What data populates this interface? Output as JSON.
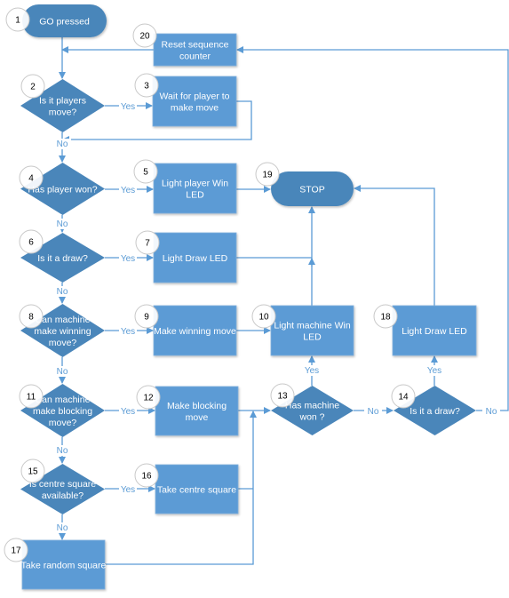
{
  "diagram": {
    "type": "flowchart",
    "colors": {
      "process_fill": "#5b9bd5",
      "decision_fill": "#4a86ba",
      "terminal_fill": "#4a86ba",
      "connector": "#5b9bd5",
      "label": "#5b9bd5",
      "number_circle_stroke": "#c8c8c8"
    },
    "nodes": [
      {
        "id": "1",
        "shape": "terminal",
        "lines": [
          "GO pressed"
        ]
      },
      {
        "id": "2",
        "shape": "decision",
        "lines": [
          "Is it players",
          "move?"
        ]
      },
      {
        "id": "3",
        "shape": "process",
        "lines": [
          "Wait for player to",
          "make move"
        ]
      },
      {
        "id": "4",
        "shape": "decision",
        "lines": [
          "Has player won?"
        ]
      },
      {
        "id": "5",
        "shape": "process",
        "lines": [
          "Light player Win",
          "LED"
        ]
      },
      {
        "id": "6",
        "shape": "decision",
        "lines": [
          "Is it a draw?"
        ]
      },
      {
        "id": "7",
        "shape": "process",
        "lines": [
          "Light Draw LED"
        ]
      },
      {
        "id": "8",
        "shape": "decision",
        "lines": [
          "Can machine",
          "make winning",
          "move?"
        ]
      },
      {
        "id": "9",
        "shape": "process",
        "lines": [
          "Make winning move"
        ]
      },
      {
        "id": "10",
        "shape": "process",
        "lines": [
          "Light machine Win",
          "LED"
        ]
      },
      {
        "id": "11",
        "shape": "decision",
        "lines": [
          "Can machine",
          "make blocking",
          "move?"
        ]
      },
      {
        "id": "12",
        "shape": "process",
        "lines": [
          "Make blocking",
          "move"
        ]
      },
      {
        "id": "13",
        "shape": "decision",
        "lines": [
          "Has machine",
          "won ?"
        ]
      },
      {
        "id": "14",
        "shape": "decision",
        "lines": [
          "Is it a draw?"
        ]
      },
      {
        "id": "15",
        "shape": "decision",
        "lines": [
          "Is centre square",
          "available?"
        ]
      },
      {
        "id": "16",
        "shape": "process",
        "lines": [
          "Take centre square"
        ]
      },
      {
        "id": "17",
        "shape": "process",
        "lines": [
          "Take random square"
        ]
      },
      {
        "id": "18",
        "shape": "process",
        "lines": [
          "Light Draw LED"
        ]
      },
      {
        "id": "19",
        "shape": "terminal",
        "lines": [
          "STOP"
        ]
      },
      {
        "id": "20",
        "shape": "process",
        "lines": [
          "Reset sequence",
          "counter"
        ]
      }
    ],
    "edges": [
      {
        "from": "1",
        "to": "2",
        "label": ""
      },
      {
        "from": "20",
        "to": "2",
        "label": ""
      },
      {
        "from": "2",
        "to": "3",
        "label": "Yes"
      },
      {
        "from": "2",
        "to": "4",
        "label": "No"
      },
      {
        "from": "3",
        "to": "4",
        "label": ""
      },
      {
        "from": "4",
        "to": "5",
        "label": "Yes"
      },
      {
        "from": "4",
        "to": "6",
        "label": "No"
      },
      {
        "from": "5",
        "to": "19",
        "label": ""
      },
      {
        "from": "6",
        "to": "7",
        "label": "Yes"
      },
      {
        "from": "6",
        "to": "8",
        "label": "No"
      },
      {
        "from": "7",
        "to": "19",
        "label": ""
      },
      {
        "from": "8",
        "to": "9",
        "label": "Yes"
      },
      {
        "from": "8",
        "to": "11",
        "label": "No"
      },
      {
        "from": "9",
        "to": "10",
        "label": ""
      },
      {
        "from": "10",
        "to": "19",
        "label": ""
      },
      {
        "from": "11",
        "to": "12",
        "label": "Yes"
      },
      {
        "from": "11",
        "to": "15",
        "label": "No"
      },
      {
        "from": "12",
        "to": "13",
        "label": ""
      },
      {
        "from": "13",
        "to": "10",
        "label": "Yes"
      },
      {
        "from": "13",
        "to": "14",
        "label": "No"
      },
      {
        "from": "14",
        "to": "18",
        "label": "Yes"
      },
      {
        "from": "14",
        "to": "20",
        "label": "No"
      },
      {
        "from": "18",
        "to": "19",
        "label": ""
      },
      {
        "from": "15",
        "to": "16",
        "label": "Yes"
      },
      {
        "from": "15",
        "to": "17",
        "label": "No"
      },
      {
        "from": "16",
        "to": "13",
        "label": ""
      },
      {
        "from": "17",
        "to": "13",
        "label": ""
      }
    ]
  }
}
